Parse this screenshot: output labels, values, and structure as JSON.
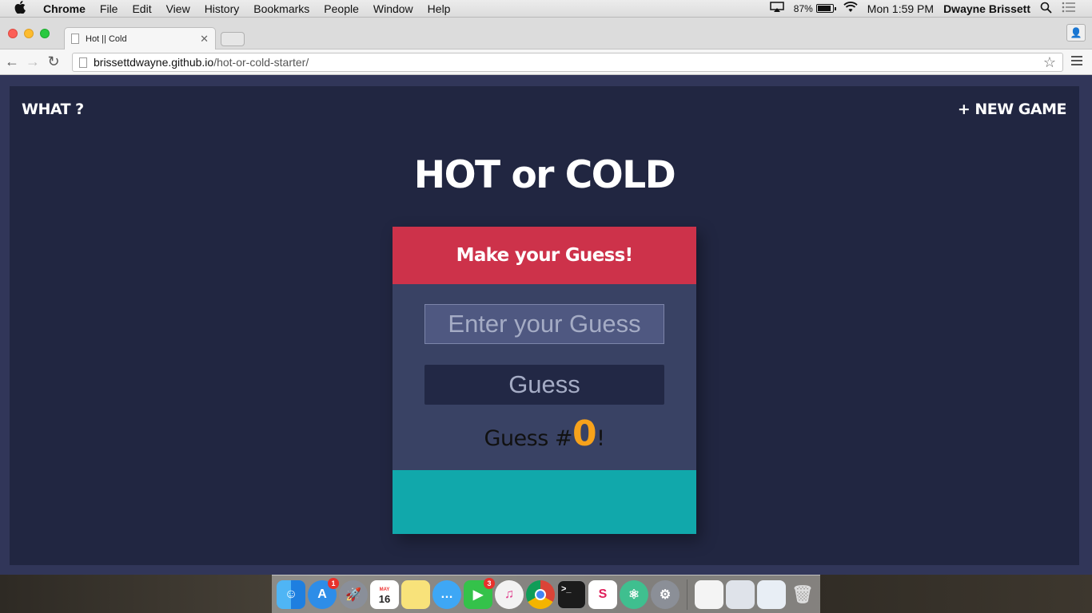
{
  "menubar": {
    "apple": "",
    "items": [
      "Chrome",
      "File",
      "Edit",
      "View",
      "History",
      "Bookmarks",
      "People",
      "Window",
      "Help"
    ],
    "battery_percent": "87%",
    "clock": "Mon 1:59 PM",
    "user": "Dwayne Brissett"
  },
  "browser": {
    "tab_title": "Hot || Cold",
    "url_host": "brissettdwayne.github.io",
    "url_path": "/hot-or-cold-starter/"
  },
  "game": {
    "nav_left": "WHAT ?",
    "nav_right": "+ NEW GAME",
    "title": "HOT or COLD",
    "prompt": "Make your Guess!",
    "input_placeholder": "Enter your Guess",
    "guess_button": "Guess",
    "counter_prefix": "Guess #",
    "counter_value": "0",
    "counter_suffix": "!"
  },
  "colors": {
    "page_bg": "#212641",
    "card_head": "#cd324a",
    "card_body": "#394264",
    "card_foot": "#11a8ab",
    "count_accent": "#f7a21b"
  },
  "dock": {
    "icons": [
      "finder-icon",
      "app-store-icon",
      "launchpad-icon",
      "calendar-icon",
      "notes-icon",
      "messages-icon",
      "facetime-icon",
      "itunes-icon",
      "chrome-icon",
      "terminal-icon",
      "slack-icon",
      "atom-icon",
      "system-preferences-icon",
      "stack-icon-1",
      "stack-icon-2",
      "stack-icon-3",
      "trash-icon"
    ],
    "calendar_month": "MAY",
    "calendar_day": "16",
    "app_store_badge": "1",
    "facetime_badge": "3"
  }
}
